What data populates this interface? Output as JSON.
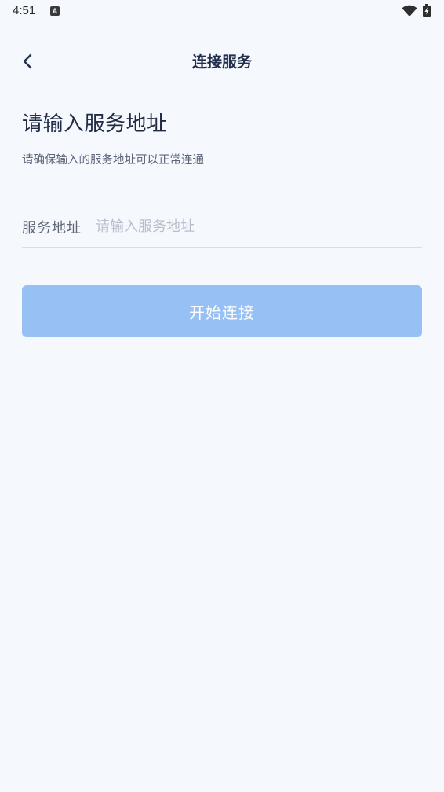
{
  "status_bar": {
    "time": "4:51",
    "a_badge": "A"
  },
  "nav": {
    "title": "连接服务"
  },
  "page": {
    "heading": "请输入服务地址",
    "subtitle": "请确保输入的服务地址可以正常连通"
  },
  "form": {
    "address_label": "服务地址",
    "address_placeholder": "请输入服务地址",
    "address_value": ""
  },
  "actions": {
    "connect_label": "开始连接"
  },
  "colors": {
    "background": "#f5f8fd",
    "primary_disabled": "#97c1f4",
    "title_text": "#23304d"
  },
  "icons": {
    "back": "chevron-left-icon",
    "wifi": "wifi-icon",
    "battery": "battery-charging-icon"
  }
}
